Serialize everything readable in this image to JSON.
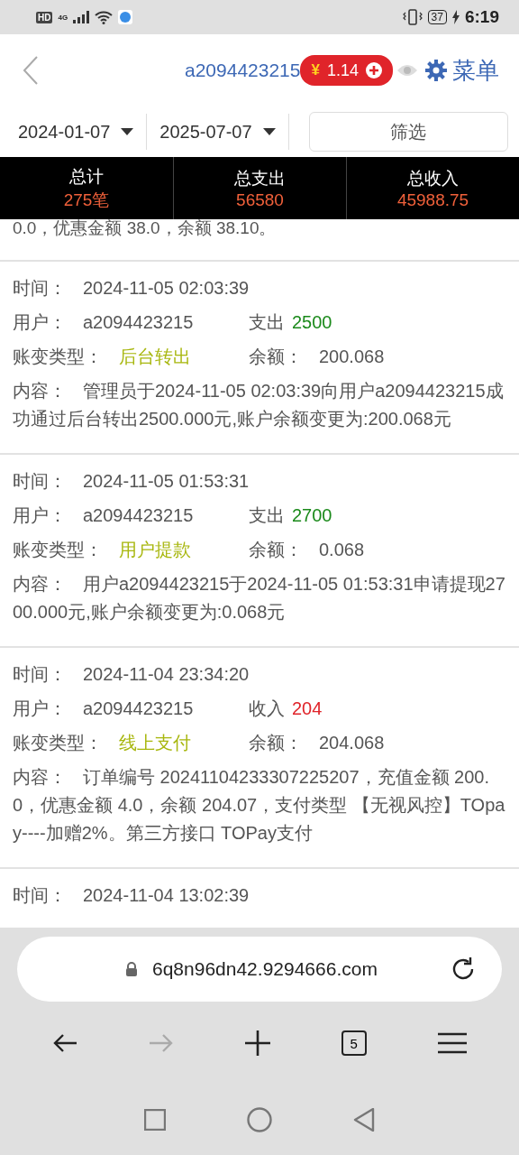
{
  "status_bar": {
    "hd": "HD",
    "network": "4G",
    "battery": "37",
    "time": "6:19"
  },
  "header": {
    "username": "a2094423215",
    "balance_symbol": "¥",
    "balance": "1.14",
    "menu": "菜单"
  },
  "filter": {
    "start_date": "2024-01-07",
    "end_date": "2025-07-07",
    "button": "筛选"
  },
  "summary": [
    {
      "label": "总计",
      "value": "275笔"
    },
    {
      "label": "总支出",
      "value": "56580"
    },
    {
      "label": "总收入",
      "value": "45988.75"
    }
  ],
  "partial_text": "0.0，优惠金额 38.0，余额 38.10。",
  "records": [
    {
      "time_label": "时间：",
      "time": "2024-11-05 02:03:39",
      "user_label": "用户：",
      "user": "a2094423215",
      "kind": "expense",
      "amount_label": "支出",
      "amount": "2500",
      "type_label": "账变类型：",
      "type": "后台转出",
      "balance_label": "余额：",
      "balance": "200.068",
      "content_label": "内容：",
      "content": "管理员于2024-11-05 02:03:39向用户a2094423215成功通过后台转出2500.000元,账户余额变更为:200.068元"
    },
    {
      "time_label": "时间：",
      "time": "2024-11-05 01:53:31",
      "user_label": "用户：",
      "user": "a2094423215",
      "kind": "expense",
      "amount_label": "支出",
      "amount": "2700",
      "type_label": "账变类型：",
      "type": "用户提款",
      "balance_label": "余额：",
      "balance": "0.068",
      "content_label": "内容：",
      "content": "用户a2094423215于2024-11-05 01:53:31申请提现2700.000元,账户余额变更为:0.068元"
    },
    {
      "time_label": "时间：",
      "time": "2024-11-04 23:34:20",
      "user_label": "用户：",
      "user": "a2094423215",
      "kind": "income",
      "amount_label": "收入",
      "amount": "204",
      "type_label": "账变类型：",
      "type": "线上支付",
      "balance_label": "余额：",
      "balance": "204.068",
      "content_label": "内容：",
      "content": "订单编号 20241104233307225207，充值金额 200.0，优惠金额 4.0，余额 204.07，支付类型 【无视风控】TOpay----加赠2%。第三方接口 TOPay支付"
    },
    {
      "time_label": "时间：",
      "time": "2024-11-04 13:02:39"
    }
  ],
  "browser": {
    "url": "6q8n96dn42.9294666.com",
    "tabs_count": "5"
  }
}
